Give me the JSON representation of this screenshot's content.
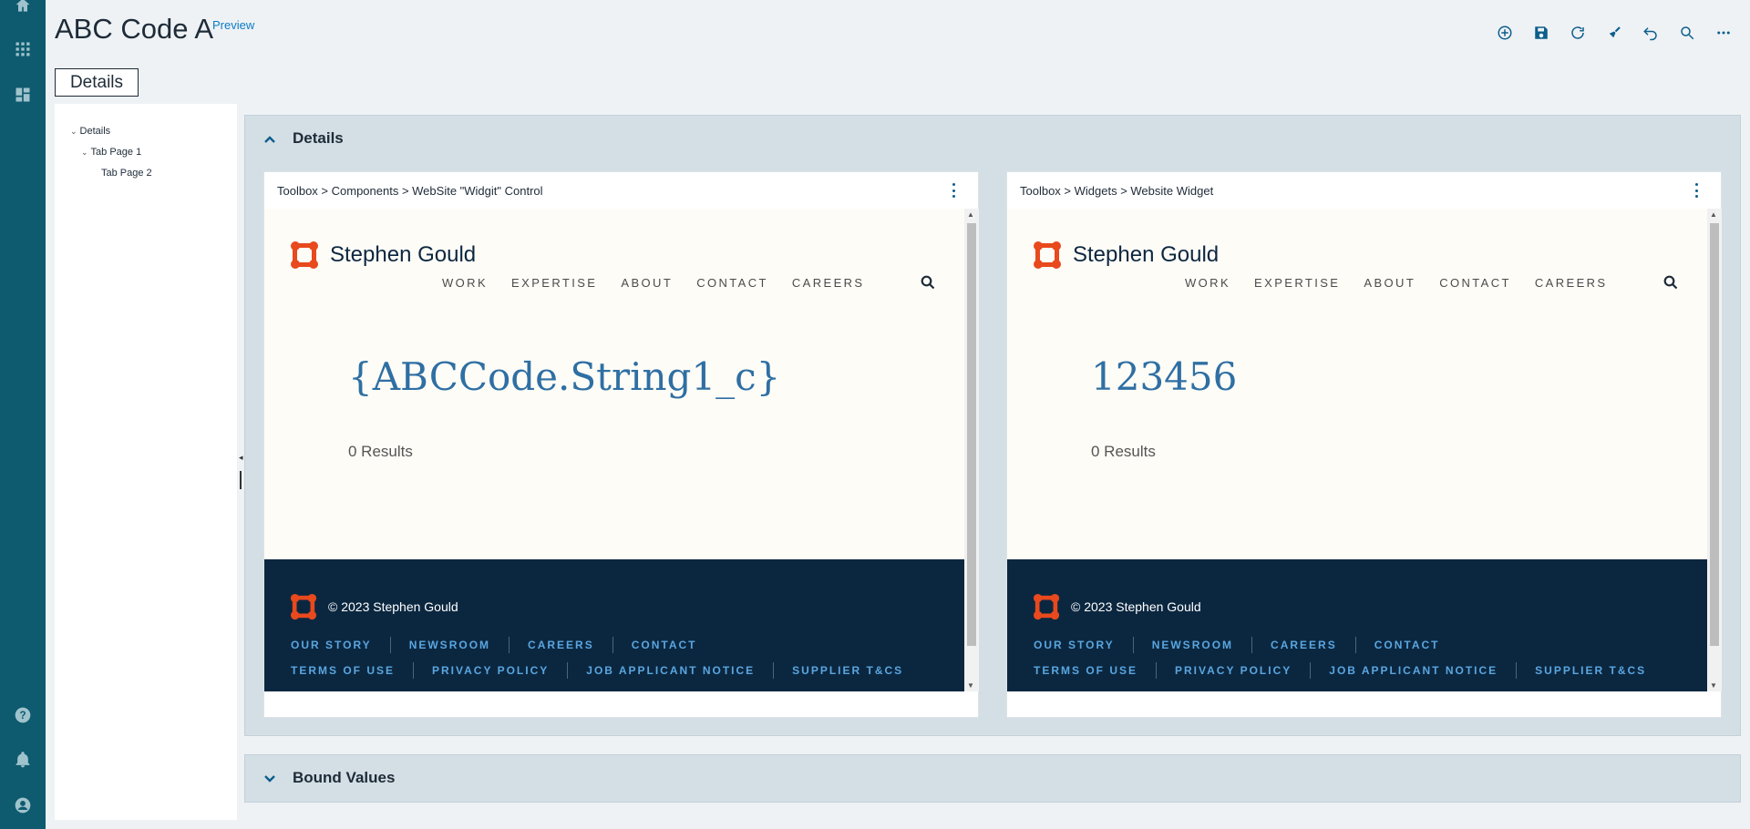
{
  "header": {
    "title": "ABC Code A",
    "preview": "Preview",
    "tab": "Details"
  },
  "tree": {
    "items": [
      {
        "label": "Details"
      },
      {
        "label": "Tab Page 1"
      },
      {
        "label": "Tab Page 2"
      }
    ]
  },
  "sections": {
    "details": "Details",
    "bound": "Bound Values"
  },
  "cards": [
    {
      "title": "Toolbox > Components > WebSite \"Widgit\" Control",
      "brand": "Stephen Gould",
      "nav": [
        "WORK",
        "EXPERTISE",
        "ABOUT",
        "CONTACT",
        "CAREERS"
      ],
      "value": "{ABCCode.String1_c}",
      "results": "0 Results",
      "copyright": "© 2023 Stephen Gould",
      "footer_row1": [
        "OUR STORY",
        "NEWSROOM",
        "CAREERS",
        "CONTACT"
      ],
      "footer_row2": [
        "TERMS OF USE",
        "PRIVACY POLICY",
        "JOB APPLICANT NOTICE",
        "SUPPLIER T&CS"
      ]
    },
    {
      "title": "Toolbox > Widgets > Website Widget",
      "brand": "Stephen Gould",
      "nav": [
        "WORK",
        "EXPERTISE",
        "ABOUT",
        "CONTACT",
        "CAREERS"
      ],
      "value": "123456",
      "results": "0 Results",
      "copyright": "© 2023 Stephen Gould",
      "footer_row1": [
        "OUR STORY",
        "NEWSROOM",
        "CAREERS",
        "CONTACT"
      ],
      "footer_row2": [
        "TERMS OF USE",
        "PRIVACY POLICY",
        "JOB APPLICANT NOTICE",
        "SUPPLIER T&CS"
      ]
    }
  ],
  "icons": {
    "rail": [
      "home-icon",
      "apps-grid-icon",
      "dashboard-icon",
      "help-icon",
      "bell-icon",
      "user-icon"
    ],
    "toolbar": [
      "add-icon",
      "save-icon",
      "refresh-icon",
      "clear-icon",
      "undo-icon",
      "search-icon",
      "more-icon"
    ]
  },
  "colors": {
    "rail": "#0e5a6e",
    "accent": "#0d5e8c",
    "brand_orange": "#e8491d",
    "footer_bg": "#0b2740",
    "value_blue": "#2f6fa3"
  }
}
